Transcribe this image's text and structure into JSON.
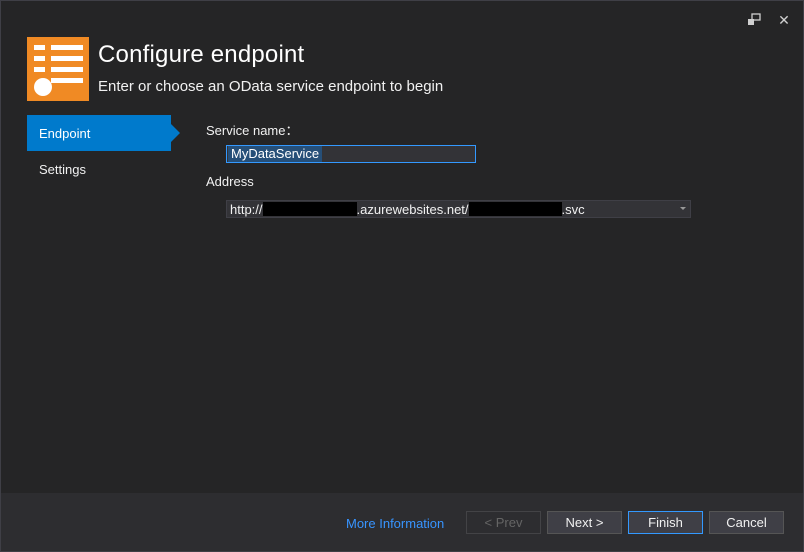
{
  "header": {
    "title": "Configure endpoint",
    "subtitle": "Enter or choose an OData service endpoint to begin"
  },
  "title_bar": {
    "icons": [
      "feedback-icon",
      "close-icon"
    ],
    "close_glyph": "✕"
  },
  "sidebar": {
    "items": [
      {
        "label": "Endpoint",
        "active": true
      },
      {
        "label": "Settings",
        "active": false
      }
    ]
  },
  "form": {
    "service_name_label": "Service name：",
    "service_name_value": "MyDataService",
    "address_label": "Address",
    "address": {
      "prefix": "http://",
      "middle": ".azurewebsites.net/",
      "suffix": ".svc"
    }
  },
  "footer": {
    "more_info": "More Information",
    "prev": "< Prev",
    "next": "Next >",
    "finish": "Finish",
    "cancel": "Cancel"
  },
  "colors": {
    "accent": "#007acc",
    "logo": "#f08a24",
    "link": "#3794ff"
  }
}
